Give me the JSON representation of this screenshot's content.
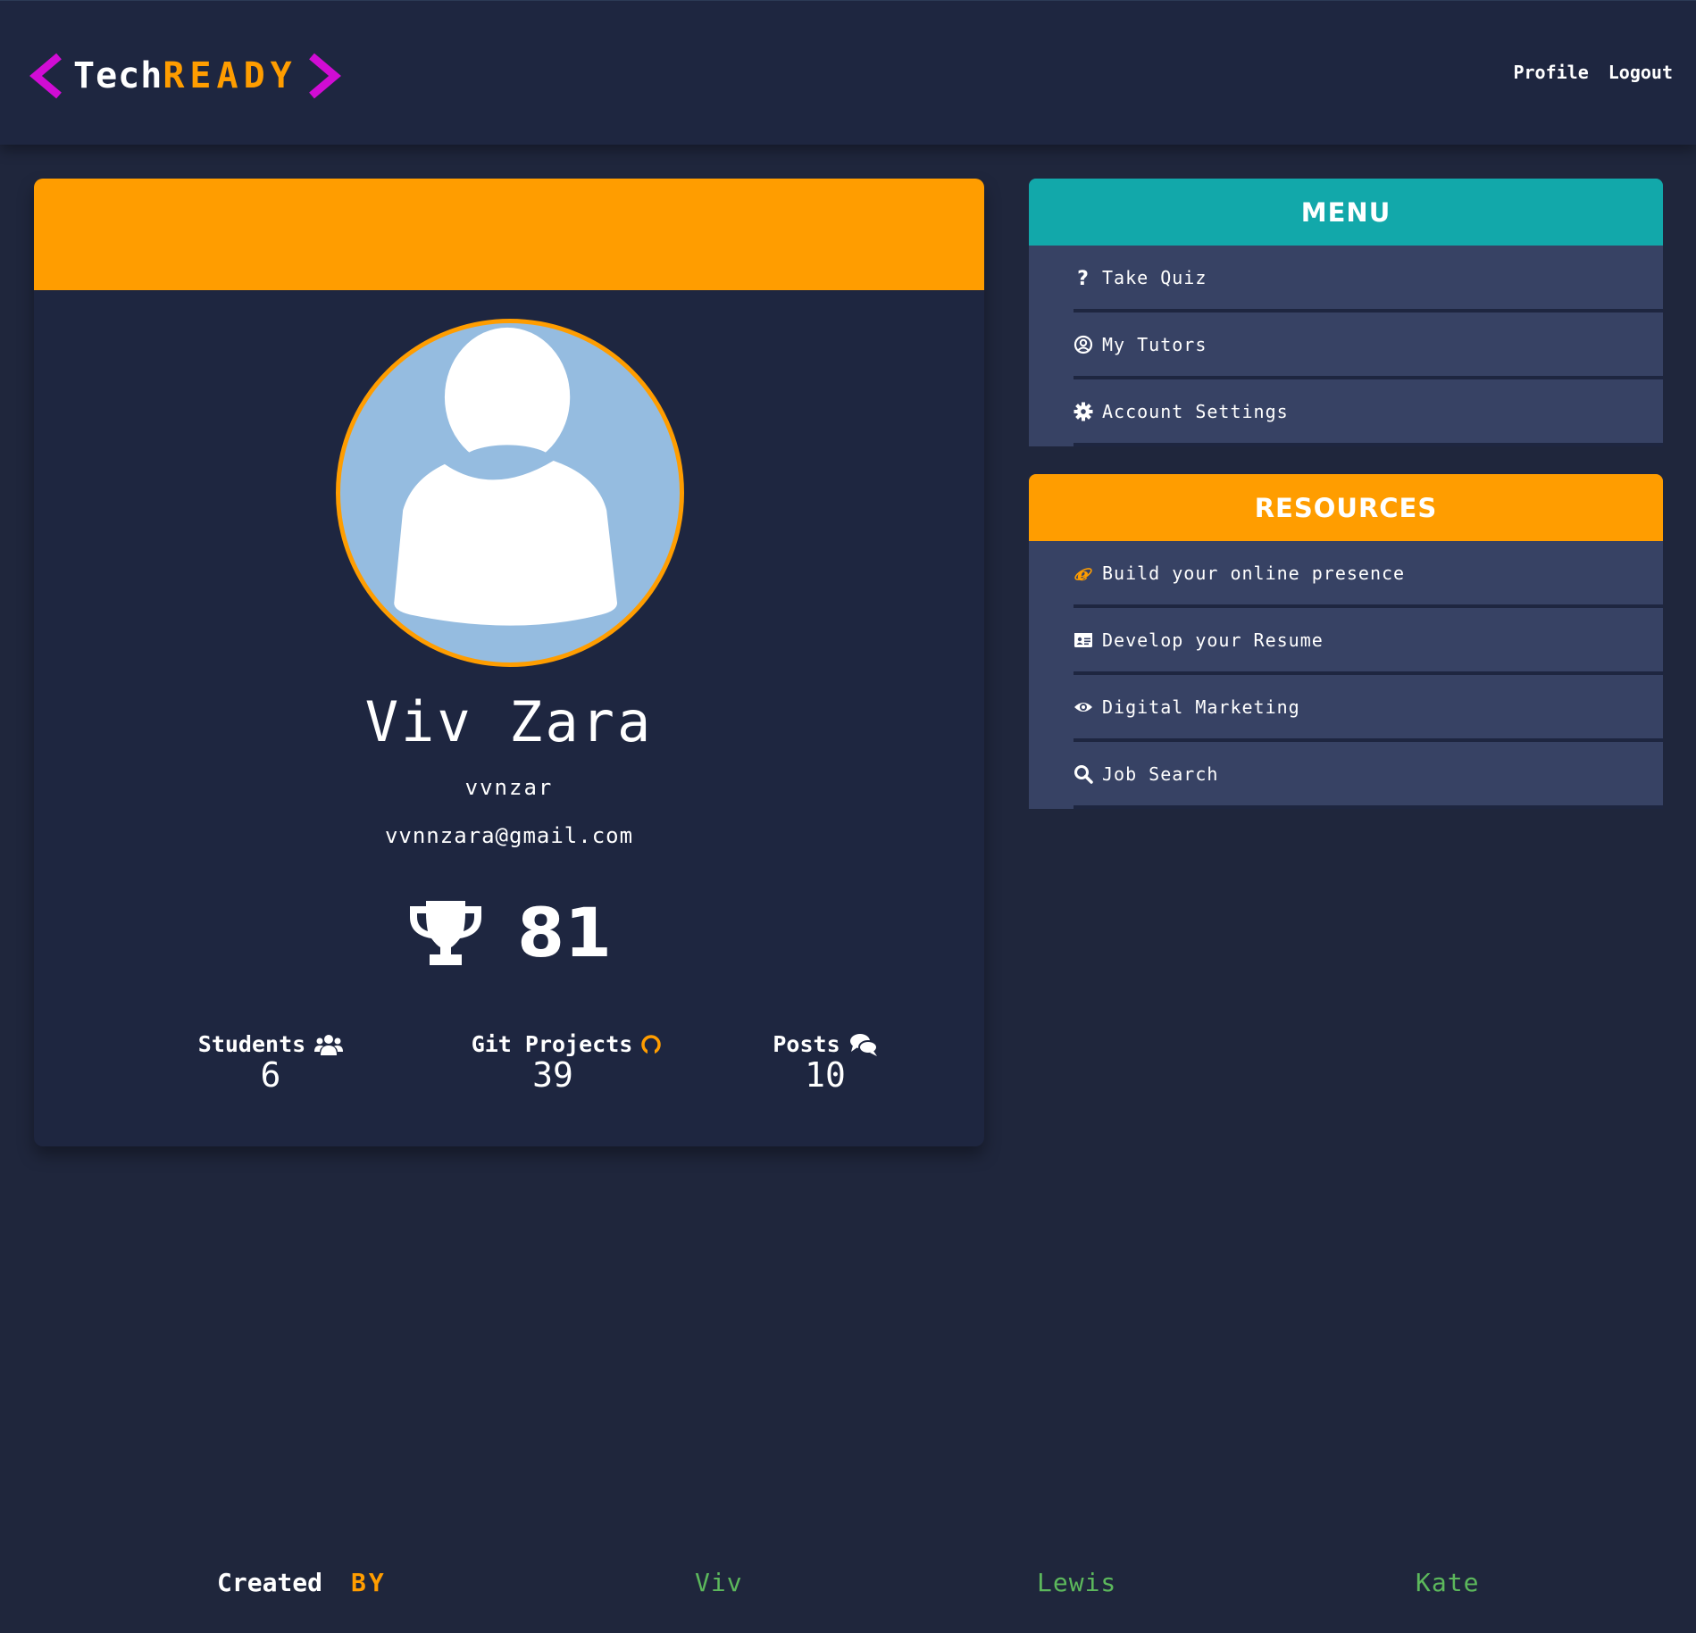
{
  "brand": {
    "tech": "Tech",
    "ready": "READY"
  },
  "nav": {
    "profile": "Profile",
    "logout": "Logout"
  },
  "profile": {
    "full_name": "Viv Zara",
    "username": "vvnzar",
    "email": "vvnnzara@gmail.com",
    "score": "81",
    "stats": {
      "students_label": "Students",
      "students_value": "6",
      "git_label": "Git Projects",
      "git_value": "39",
      "posts_label": "Posts",
      "posts_value": "10"
    }
  },
  "menu": {
    "title": "MENU",
    "items": [
      {
        "label": "Take Quiz",
        "icon": "question-icon"
      },
      {
        "label": "My Tutors",
        "icon": "user-circle-icon"
      },
      {
        "label": "Account Settings",
        "icon": "gear-icon"
      }
    ]
  },
  "resources": {
    "title": "RESOURCES",
    "items": [
      {
        "label": "Build your online presence",
        "icon": "internet-explorer-icon"
      },
      {
        "label": "Develop your Resume",
        "icon": "id-card-icon"
      },
      {
        "label": "Digital Marketing",
        "icon": "eye-icon"
      },
      {
        "label": "Job Search",
        "icon": "search-icon"
      }
    ]
  },
  "footer": {
    "created": "Created",
    "by": "BY",
    "authors": [
      "Viv",
      "Lewis",
      "Kate"
    ]
  },
  "colors": {
    "background": "#1f263c",
    "accent_orange": "#ff9d00",
    "accent_teal": "#12a8aa",
    "accent_magenta": "#d10cd4",
    "panel": "#374264",
    "author_green": "#5cb85c"
  }
}
